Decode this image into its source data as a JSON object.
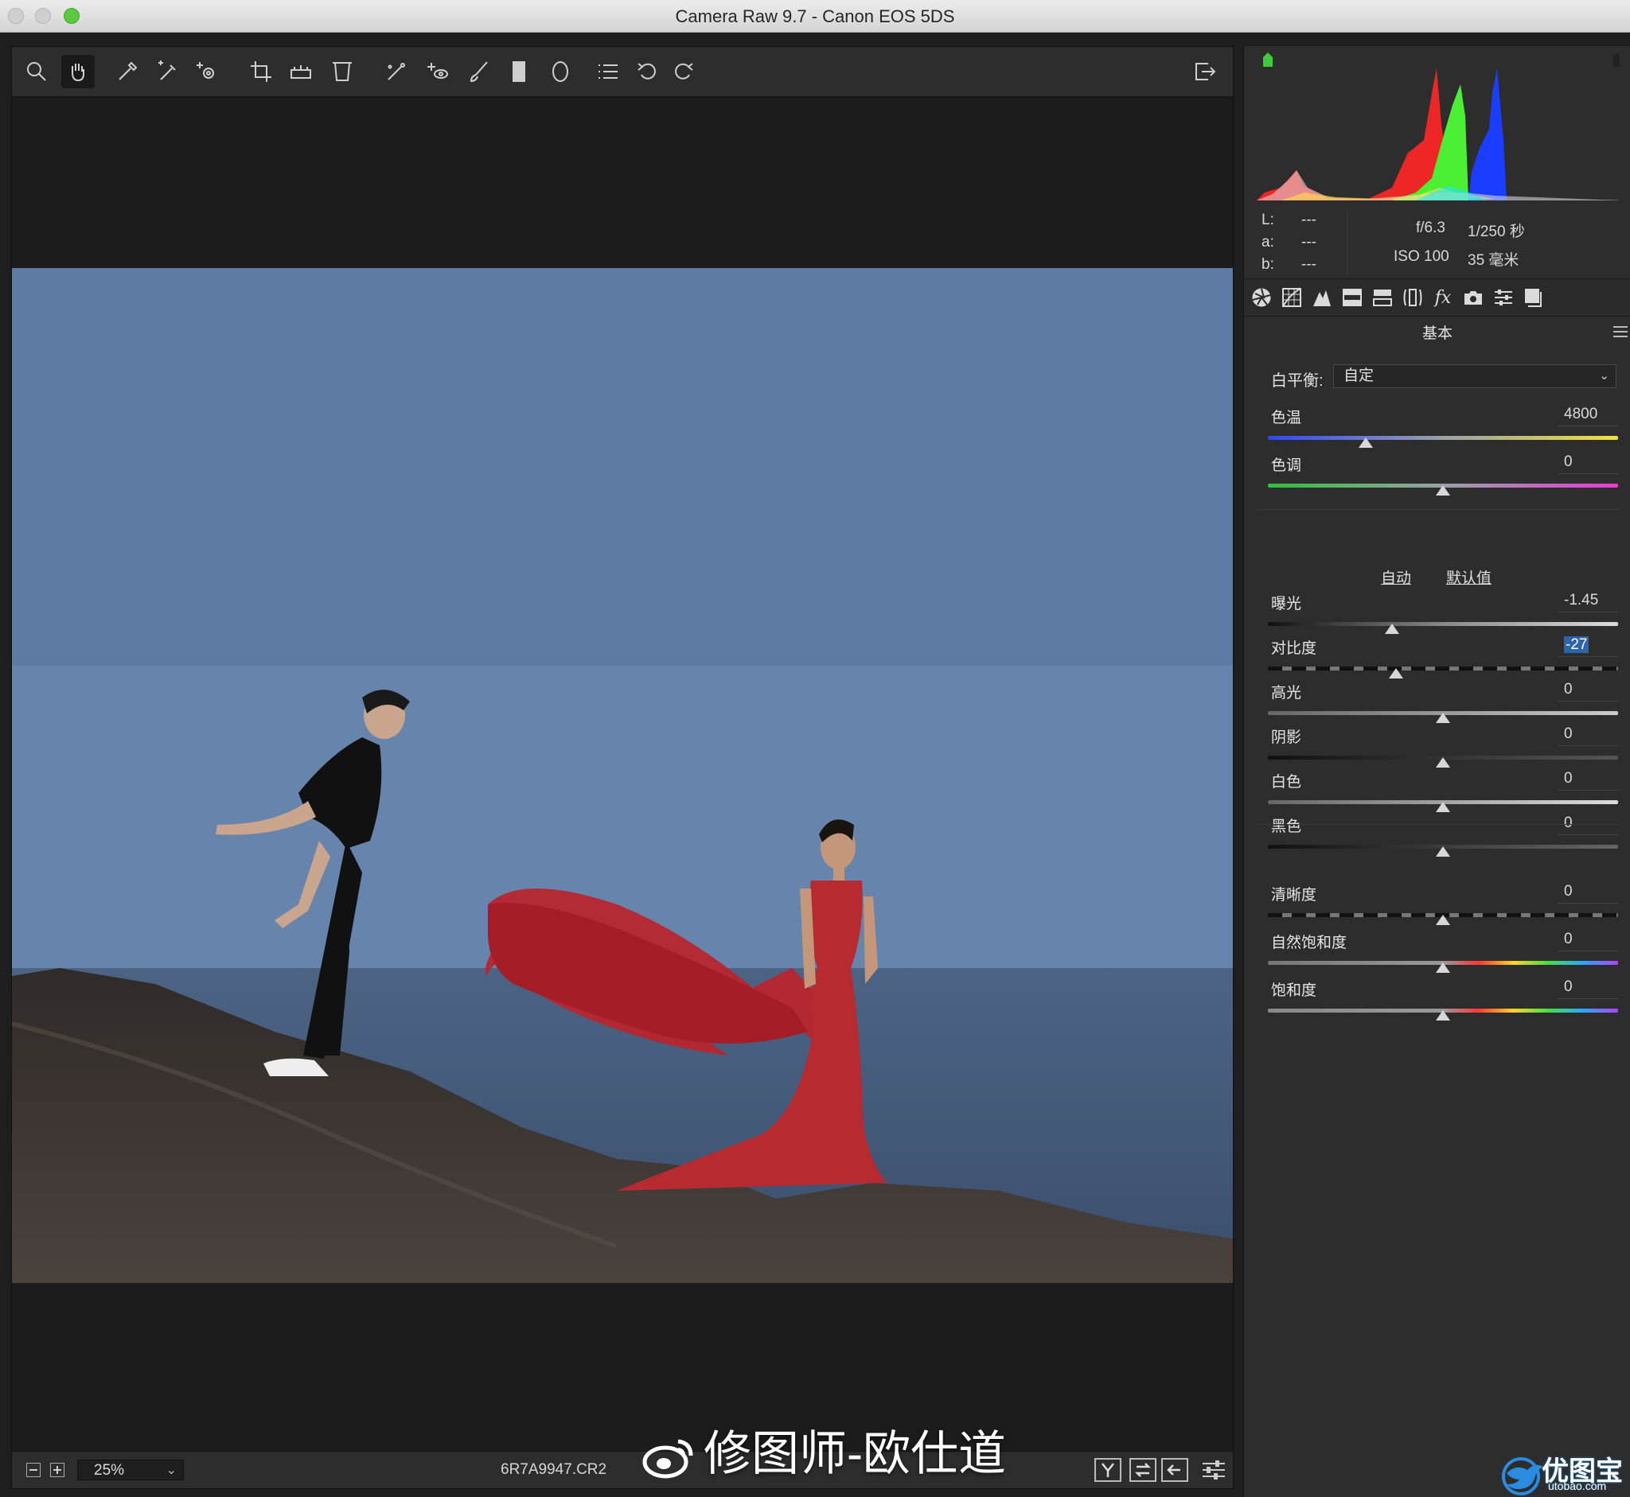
{
  "window": {
    "title": "Camera Raw 9.7 -  Canon EOS 5DS"
  },
  "toolbar": {
    "tools": [
      "zoom-icon",
      "hand-icon",
      "white-balance-icon",
      "color-sampler-icon",
      "targeted-adjustment-icon",
      "crop-icon",
      "straighten-icon",
      "transform-icon",
      "spot-removal-icon",
      "red-eye-icon",
      "adjustment-brush-icon",
      "graduated-filter-icon",
      "radial-filter-icon",
      "preferences-icon",
      "rotate-left-icon",
      "rotate-right-icon"
    ],
    "export_icon": "toggle-fullscreen-icon"
  },
  "status": {
    "zoom": "25%",
    "filename": "6R7A9947.CR2"
  },
  "watermark": {
    "text": "修图师-欧仕道"
  },
  "histogram": {
    "clip_shadow_color": "#3ecb3a"
  },
  "readouts": {
    "L_label": "L:",
    "L_value": "---",
    "a_label": "a:",
    "a_value": "---",
    "b_label": "b:",
    "b_value": "---",
    "aperture": "f/6.3",
    "shutter": "1/250 秒",
    "iso": "ISO 100",
    "focal": "35 毫米"
  },
  "panel": {
    "title": "基本",
    "tab_fx": "fx",
    "wb_label": "白平衡:",
    "wb_value": "自定",
    "auto_link": "自动",
    "default_link": "默认值",
    "sliders": [
      {
        "label": "色温",
        "value": "4800",
        "position": 0.28
      },
      {
        "label": "色调",
        "value": "0",
        "position": 0.5
      },
      {
        "label": "曝光",
        "value": "-1.45",
        "position": 0.355
      },
      {
        "label": "对比度",
        "value": "-27",
        "position": 0.365,
        "highlighted": true
      },
      {
        "label": "高光",
        "value": "0",
        "position": 0.5
      },
      {
        "label": "阴影",
        "value": "0",
        "position": 0.5
      },
      {
        "label": "白色",
        "value": "0",
        "position": 0.5
      },
      {
        "label": "黑色",
        "value": "0",
        "position": 0.5
      },
      {
        "label": "清晰度",
        "value": "0",
        "position": 0.5
      },
      {
        "label": "自然饱和度",
        "value": "0",
        "position": 0.5
      },
      {
        "label": "饱和度",
        "value": "0",
        "position": 0.5
      }
    ]
  },
  "logo": {
    "name": "优图宝",
    "url": "utobao.com"
  }
}
